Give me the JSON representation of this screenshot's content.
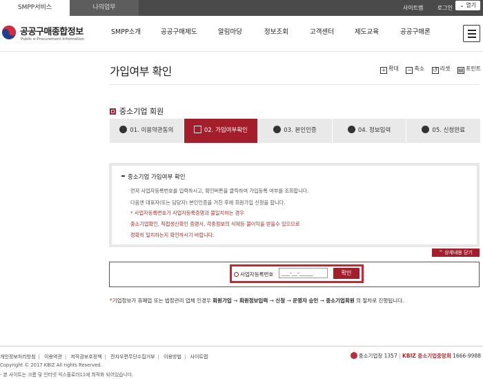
{
  "topbar": {
    "tab_active": "SMPP서비스",
    "tab_inactive": "나의업무",
    "sitemap": "사이트맵",
    "login": "로그인",
    "open_btn": "열기"
  },
  "header": {
    "logo_title": "공공구매종합정보",
    "logo_sub": "Public e-Procurement Information",
    "menu": [
      "SMPP소개",
      "공공구매제도",
      "알림마당",
      "정보조회",
      "고객센터",
      "제도교육",
      "공공구매론"
    ]
  },
  "page": {
    "title": "가입여부 확인",
    "tools": {
      "zoom_in": "확대",
      "zoom_out": "축소",
      "reset": "리셋",
      "print": "프린트"
    }
  },
  "section": {
    "title": "중소기업 회원",
    "steps": [
      "01. 이용약관동의",
      "02. 가입여부확인",
      "03. 본인인증",
      "04. 정보입력",
      "05. 신청완료"
    ],
    "active_step": 1
  },
  "notice": {
    "heading": "중소기업 가입여부 확인",
    "line1": "먼저 사업자등록번호를 입력하시고, 확인버튼을 클릭하여 가입등록 여부를 조회합니다.",
    "line2": "다음엔 대표자(또는 담당자) 본인인증을 거친 후에 회원가입 신청을 합니다.",
    "line3": "* 사업자등록번호가 사업자등록증명과 불일치하는 경우",
    "line4": "중소기업확인, 직접생산확인 증명서, 각종정보의 삭제등 불이익을 받을수 있으므로",
    "line5": "정확히 일치하는지 확인하시기 바랍니다.",
    "detail_close": "상세내용 닫기"
  },
  "form": {
    "label": "사업자등록번호",
    "input_value": "___-__-_____",
    "confirm": "확인"
  },
  "process": {
    "star": "*",
    "text1": "기업정보가 휴폐업 또는 법정관리 업체 인경우 ",
    "b1": "회원가입",
    "arrow": " → ",
    "b2": "회원정보입력",
    "s3": "신청",
    "s4": "운영자 승인",
    "b5": "중소기업회원",
    "tail": " 의 절차로 진행됩니다."
  },
  "footer": {
    "links": [
      "개인정보처리방침",
      "이용약관",
      "저작권보호정책",
      "전자우편무단수집거부",
      "이용방법",
      "사이트맵"
    ],
    "copyright": "Copyright © 2017 KBIZ All rights Reserved.",
    "browser_note": "- 본 사이트는 크롬 및 인터넷 익스플로러11에 최적화 되어있습니다.",
    "phone1_label": "중소기업청",
    "phone1": "1357",
    "phone2_label": "KBIZ 중소기업중앙회",
    "phone2": "1666-9988"
  }
}
